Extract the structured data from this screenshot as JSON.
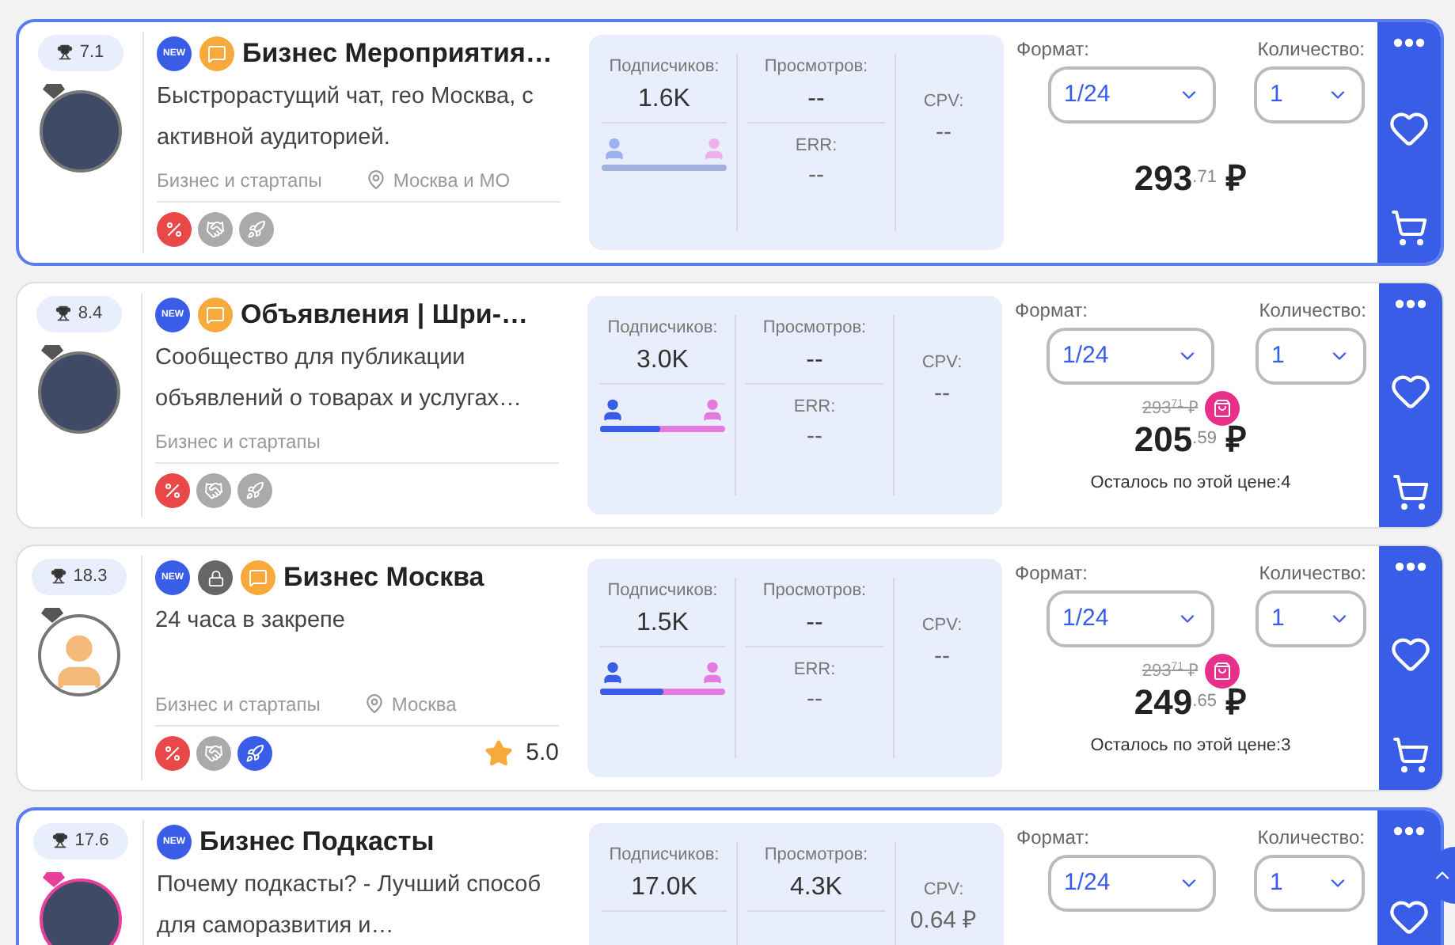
{
  "cards": [
    {
      "highlighted": true,
      "score": "7.1",
      "gem": {
        "color": "#555555"
      },
      "avatar": {
        "kind": "photo"
      },
      "badges": [
        {
          "kind": "new",
          "text": "NEW"
        },
        {
          "kind": "chat"
        }
      ],
      "title": "Бизнес Мероприятия…",
      "description": "Быстрорастущий чат, гео Москва, с активной аудиторией.",
      "category": "Бизнес и стартапы",
      "location": "Москва и МО",
      "features": [
        {
          "kind": "discount",
          "on": true
        },
        {
          "kind": "deal",
          "on": false
        },
        {
          "kind": "boost",
          "on": false
        }
      ],
      "subscribers_label": "Подписчиков:",
      "subscribers": "1.6K",
      "gender_known": false,
      "views_label": "Просмотров:",
      "views": "--",
      "err_label": "ERR:",
      "err": "--",
      "cpv_label": "CPV:",
      "cpv": "--",
      "format_label": "Формат:",
      "format": "1/24",
      "quantity_label": "Количество:",
      "quantity": "1",
      "price": "293",
      "price_cents": ".71",
      "currency": "₽"
    },
    {
      "highlighted": false,
      "score": "8.4",
      "gem": {
        "color": "#555555"
      },
      "avatar": {
        "kind": "photo"
      },
      "badges": [
        {
          "kind": "new",
          "text": "NEW"
        },
        {
          "kind": "chat"
        }
      ],
      "title": "Объявления | Шри-…",
      "description": "Сообщество для публикации объявлений о товарах и услугах…",
      "category": "Бизнес и стартапы",
      "features": [
        {
          "kind": "discount",
          "on": true
        },
        {
          "kind": "deal",
          "on": false
        },
        {
          "kind": "boost",
          "on": false
        }
      ],
      "subscribers_label": "Подписчиков:",
      "subscribers": "3.0K",
      "gender_known": true,
      "level": 0.48,
      "views_label": "Просмотров:",
      "views": "--",
      "err_label": "ERR:",
      "err": "--",
      "cpv_label": "CPV:",
      "cpv": "--",
      "format_label": "Формат:",
      "format": "1/24",
      "quantity_label": "Количество:",
      "quantity": "1",
      "old_price": "293",
      "old_cents": "71",
      "old_currency": "₽",
      "price": "205",
      "price_cents": ".59",
      "currency": "₽",
      "remaining": "Осталось по этой цене:4"
    },
    {
      "highlighted": false,
      "score": "18.3",
      "gem": {
        "color": "#555555"
      },
      "avatar": {
        "kind": "silhouette"
      },
      "badges": [
        {
          "kind": "new",
          "text": "NEW"
        },
        {
          "kind": "lock"
        },
        {
          "kind": "chat"
        }
      ],
      "title": "Бизнес Москва",
      "description": "24 часа в закрепе",
      "category": "Бизнес и стартапы",
      "location": "Москва",
      "features": [
        {
          "kind": "discount",
          "on": true
        },
        {
          "kind": "deal",
          "on": false
        },
        {
          "kind": "boost",
          "on": true
        }
      ],
      "rating": "5.0",
      "subscribers_label": "Подписчиков:",
      "subscribers": "1.5K",
      "gender_known": true,
      "level": 0.5,
      "views_label": "Просмотров:",
      "views": "--",
      "err_label": "ERR:",
      "err": "--",
      "cpv_label": "CPV:",
      "cpv": "--",
      "format_label": "Формат:",
      "format": "1/24",
      "quantity_label": "Количество:",
      "quantity": "1",
      "old_price": "293",
      "old_cents": "71",
      "old_currency": "₽",
      "price": "249",
      "price_cents": ".65",
      "currency": "₽",
      "remaining": "Осталось по этой цене:3"
    },
    {
      "highlighted": true,
      "score": "17.6",
      "gem": {
        "color": "#e83e9c"
      },
      "avatar": {
        "kind": "photo"
      },
      "badges": [
        {
          "kind": "new",
          "text": "NEW"
        }
      ],
      "title": "Бизнес Подкасты",
      "description": "Почему подкасты? - Лучший способ для саморазвития и…",
      "subscribers_label": "Подписчиков:",
      "subscribers": "17.0K",
      "views_label": "Просмотров:",
      "views": "4.3K",
      "cpv_label": "CPV:",
      "cpv": "0.64 ₽",
      "format_label": "Формат:",
      "format": "1/24",
      "quantity_label": "Количество:",
      "quantity": "1"
    }
  ]
}
